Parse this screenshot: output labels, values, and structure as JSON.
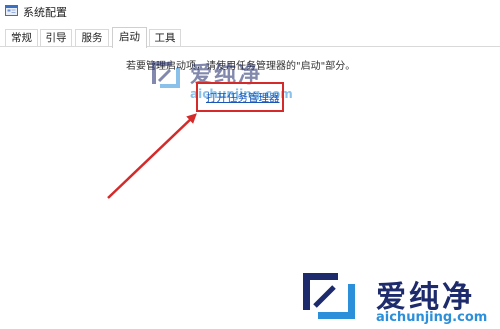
{
  "window": {
    "title": "系统配置"
  },
  "tabs": [
    {
      "label": "常规"
    },
    {
      "label": "引导"
    },
    {
      "label": "服务"
    },
    {
      "label": "启动",
      "active": true
    },
    {
      "label": "工具"
    }
  ],
  "startup": {
    "info": "若要管理启动项，请使用任务管理器的\"启动\"部分。",
    "link": "打开任务管理器"
  },
  "watermark": {
    "cn": "爱纯净",
    "url": "aichunjing.com"
  },
  "colors": {
    "annotation": "#d42a2a",
    "link": "#1a56b8",
    "watermark_blue": "#2b8fd9",
    "watermark_dark": "#1d2a6b"
  }
}
